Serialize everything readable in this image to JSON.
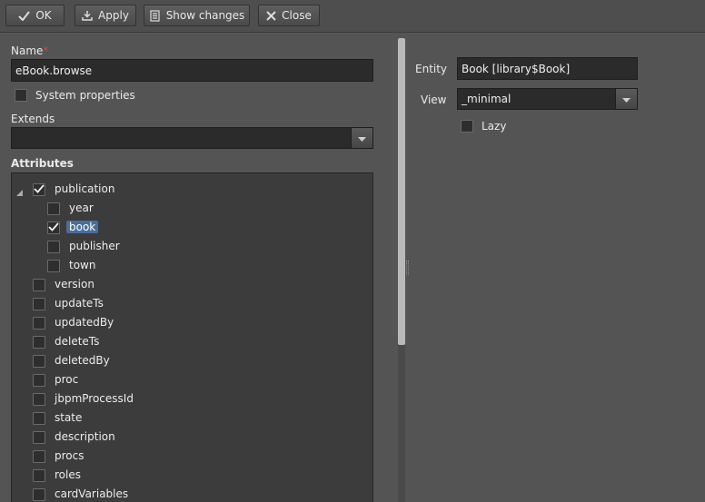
{
  "toolbar": {
    "ok_label": "OK",
    "apply_label": "Apply",
    "show_changes_label": "Show changes",
    "close_label": "Close"
  },
  "form": {
    "name_label": "Name",
    "name_required_mark": "*",
    "name_value": "eBook.browse",
    "system_properties_label": "System properties",
    "system_properties_checked": false,
    "extends_label": "Extends",
    "extends_value": "",
    "attributes_label": "Attributes"
  },
  "attributes": [
    {
      "label": "publication",
      "checked": true,
      "level": 0,
      "expanded": true
    },
    {
      "label": "year",
      "checked": false,
      "level": 1
    },
    {
      "label": "book",
      "checked": true,
      "level": 1,
      "selected": true
    },
    {
      "label": "publisher",
      "checked": false,
      "level": 1
    },
    {
      "label": "town",
      "checked": false,
      "level": 1
    },
    {
      "label": "version",
      "checked": false,
      "level": 0
    },
    {
      "label": "updateTs",
      "checked": false,
      "level": 0
    },
    {
      "label": "updatedBy",
      "checked": false,
      "level": 0
    },
    {
      "label": "deleteTs",
      "checked": false,
      "level": 0
    },
    {
      "label": "deletedBy",
      "checked": false,
      "level": 0
    },
    {
      "label": "proc",
      "checked": false,
      "level": 0
    },
    {
      "label": "jbpmProcessId",
      "checked": false,
      "level": 0
    },
    {
      "label": "state",
      "checked": false,
      "level": 0
    },
    {
      "label": "description",
      "checked": false,
      "level": 0
    },
    {
      "label": "procs",
      "checked": false,
      "level": 0
    },
    {
      "label": "roles",
      "checked": false,
      "level": 0
    },
    {
      "label": "cardVariables",
      "checked": false,
      "level": 0
    }
  ],
  "right": {
    "entity_label": "Entity",
    "entity_value": "Book [library$Book]",
    "view_label": "View",
    "view_value": "_minimal",
    "lazy_label": "Lazy",
    "lazy_checked": false
  },
  "colors": {
    "background": "#545454",
    "field": "#2b2b2b",
    "selection": "#4a6e9a",
    "required": "#e0403a"
  }
}
